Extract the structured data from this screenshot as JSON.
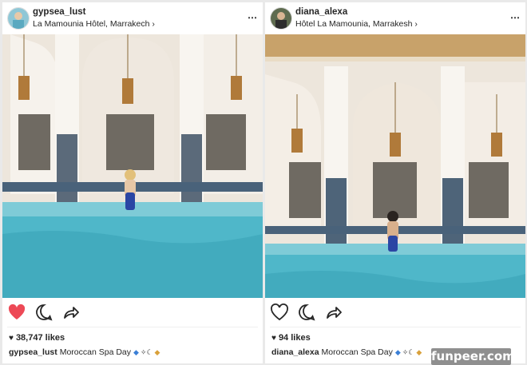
{
  "posts": [
    {
      "username": "gypsea_lust",
      "location": "La Mamounia Hôtel, Marrakech",
      "likes": "38,747 likes",
      "liked": true,
      "caption_user": "gypsea_lust",
      "caption_text": "Moroccan Spa Day"
    },
    {
      "username": "diana_alexa",
      "location": "Hôtel La Mamounia, Marrakesh",
      "likes": "94 likes",
      "liked": false,
      "caption_user": "diana_alexa",
      "caption_text": "Moroccan Spa Day"
    }
  ],
  "icons": {
    "more": "⋯",
    "chevron": "›",
    "like_heart_mini": "♥",
    "emoji_diamond": "◆",
    "emoji_sparkle_moon": "✧☾",
    "emoji_gold": "◆"
  },
  "colors": {
    "liked_heart": "#ed4956",
    "pool": "#4fb7c9",
    "arch_white": "#f3efe8"
  },
  "watermark": "funpeer.com"
}
